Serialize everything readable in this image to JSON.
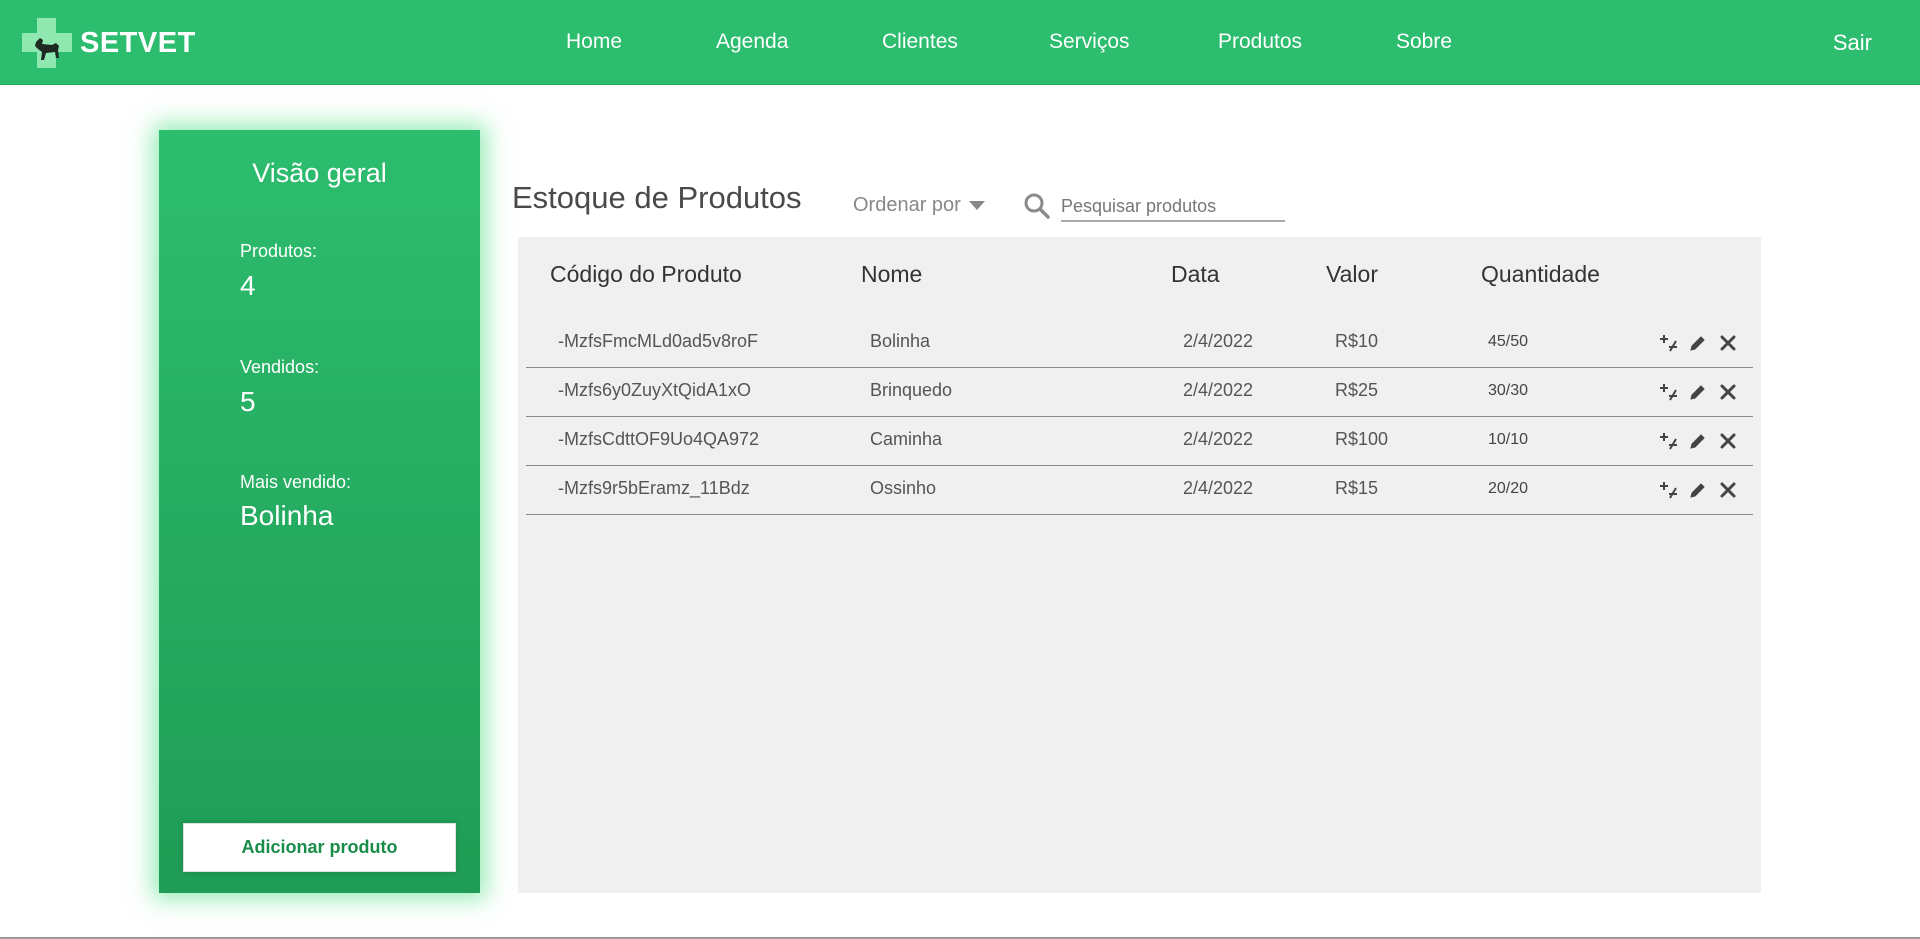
{
  "nav": {
    "brand": "SETVET",
    "links": [
      "Home",
      "Agenda",
      "Clientes",
      "Serviços",
      "Produtos",
      "Sobre"
    ],
    "logout": "Sair"
  },
  "sidebar": {
    "title": "Visão geral",
    "stats": [
      {
        "label": "Produtos:",
        "value": "4"
      },
      {
        "label": "Vendidos:",
        "value": "5"
      },
      {
        "label": "Mais vendido:",
        "value": "Bolinha"
      }
    ],
    "add_button": "Adicionar produto"
  },
  "main": {
    "title": "Estoque de Produtos",
    "sort_label": "Ordenar por",
    "search_placeholder": "Pesquisar produtos"
  },
  "table": {
    "headers": [
      "Código do Produto",
      "Nome",
      "Data",
      "Valor",
      "Quantidade"
    ],
    "rows": [
      {
        "code": "-MzfsFmcMLd0ad5v8roF",
        "name": "Bolinha",
        "date": "2/4/2022",
        "price": "R$10",
        "qty": "45/50"
      },
      {
        "code": "-Mzfs6y0ZuyXtQidA1xO",
        "name": "Brinquedo",
        "date": "2/4/2022",
        "price": "R$25",
        "qty": "30/30"
      },
      {
        "code": "-MzfsCdttOF9Uo4QA972",
        "name": "Caminha",
        "date": "2/4/2022",
        "price": "R$100",
        "qty": "10/10"
      },
      {
        "code": "-Mzfs9r5bEramz_11Bdz",
        "name": "Ossinho",
        "date": "2/4/2022",
        "price": "R$15",
        "qty": "20/20"
      }
    ]
  },
  "icons": {
    "logo": "vet-cross-dog-icon",
    "search": "search-icon",
    "sort": "caret-down-icon",
    "row_actions": [
      "plus-minus-icon",
      "pencil-icon",
      "close-icon"
    ]
  },
  "colors": {
    "primary": "#2dbd6e",
    "primary_dark": "#1f9c55",
    "panel": "#f0f0f0",
    "button_text": "#1a8c4a"
  }
}
